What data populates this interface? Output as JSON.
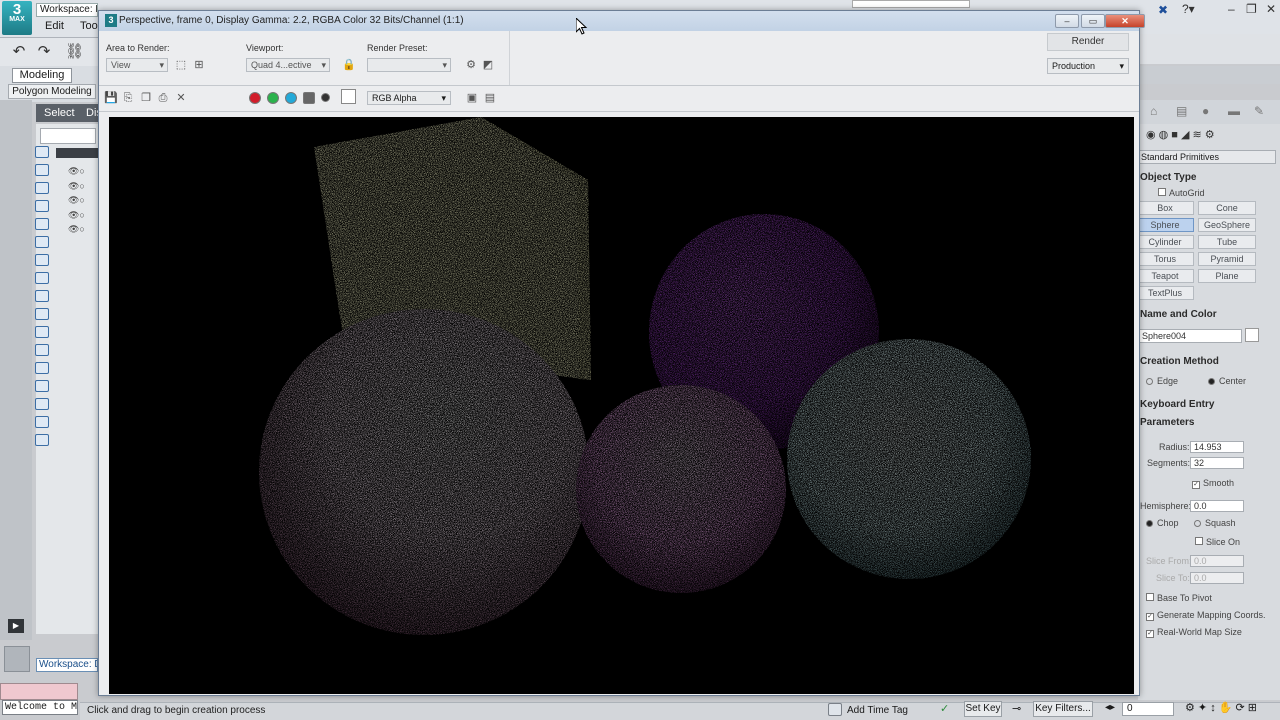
{
  "app": {
    "logo_text": "3",
    "logo_sub": "MAX",
    "workspace_top": "Workspace: Default",
    "menu": [
      "Edit",
      "Tools"
    ],
    "ribbon_tab": "Modeling",
    "ribbon_subtab": "Polygon Modeling",
    "scene_explorer_tab": "Select",
    "scene_explorer_tab2": "Display",
    "workspace_bottom": "Workspace: Default",
    "welcome": "Welcome to M",
    "status_text": "Click and drag to begin creation process",
    "add_time_tag": "Add Time Tag",
    "set_key": "Set Key",
    "key_filters": "Key Filters...",
    "frame_value": "0"
  },
  "command_panel": {
    "primitive_type": "Standard Primitives",
    "object_type_head": "Object Type",
    "autogrid": "AutoGrid",
    "buttons": [
      "Box",
      "Cone",
      "Sphere",
      "GeoSphere",
      "Cylinder",
      "Tube",
      "Torus",
      "Pyramid",
      "Teapot",
      "Plane",
      "TextPlus"
    ],
    "active_button": "Sphere",
    "name_color_head": "Name and Color",
    "object_name": "Sphere004",
    "creation_method_head": "Creation Method",
    "creation_edge": "Edge",
    "creation_center": "Center",
    "keyboard_entry_head": "Keyboard Entry",
    "parameters_head": "Parameters",
    "radius_label": "Radius:",
    "radius_value": "14.953",
    "segments_label": "Segments:",
    "segments_value": "32",
    "smooth": "Smooth",
    "hemisphere_label": "Hemisphere:",
    "hemisphere_value": "0.0",
    "chop": "Chop",
    "squash": "Squash",
    "slice_on": "Slice On",
    "slice_from_label": "Slice From:",
    "slice_from_value": "0.0",
    "slice_to_label": "Slice To:",
    "slice_to_value": "0.0",
    "base_to_pivot": "Base To Pivot",
    "gen_mapping": "Generate Mapping Coords.",
    "real_world": "Real-World Map Size"
  },
  "render_window": {
    "title": "Perspective, frame 0, Display Gamma: 2.2, RGBA Color 32 Bits/Channel (1:1)",
    "area_label": "Area to Render:",
    "area_value": "View",
    "viewport_label": "Viewport:",
    "viewport_value": "Quad 4...ective",
    "preset_label": "Render Preset:",
    "preset_value": "",
    "render_button": "Render",
    "production": "Production",
    "channel_value": "RGB Alpha",
    "channel_colors": [
      "#d11d2a",
      "#2bb24c",
      "#23a9d8",
      "#666666",
      "#333333"
    ]
  },
  "scene": {
    "background": "#000000",
    "cube_color": "#f3f3c4",
    "sphere_colors": {
      "white_pink": "#fbe8f6",
      "purple": "#c564ee",
      "pink": "#f0a8ef",
      "cyan": "#d4f3f6"
    }
  }
}
